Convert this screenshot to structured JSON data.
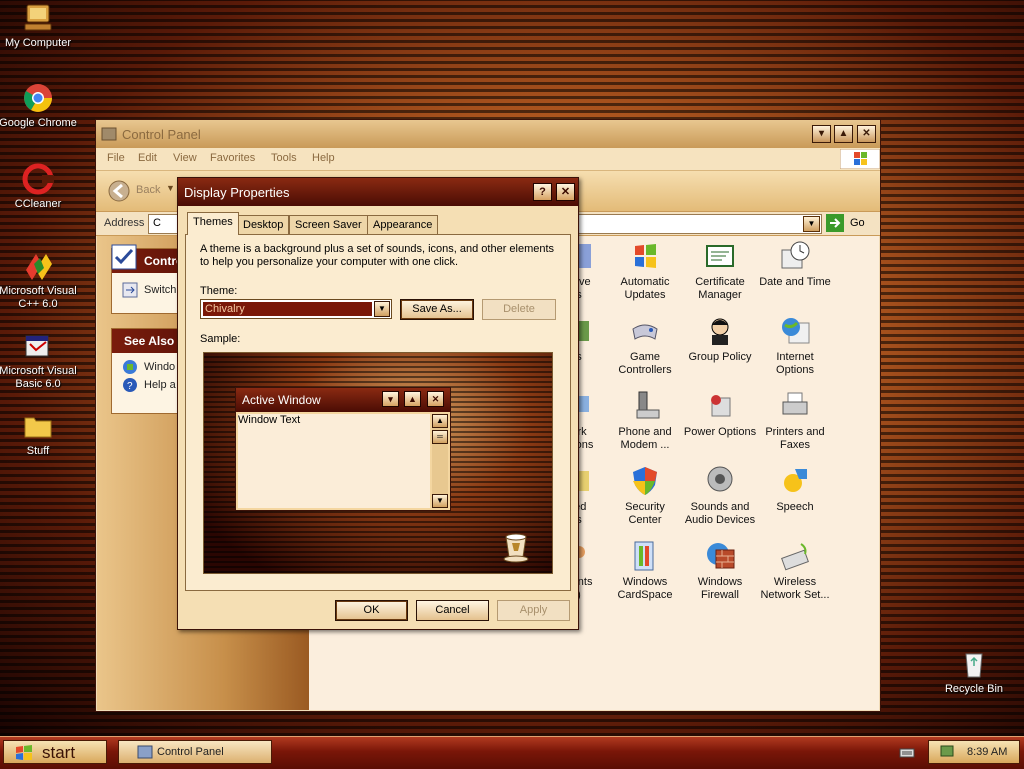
{
  "desktop": {
    "icons": [
      {
        "label": "My Computer"
      },
      {
        "label": "Google Chrome"
      },
      {
        "label": "CCleaner"
      },
      {
        "label": "Microsoft Visual C++ 6.0"
      },
      {
        "label": "Microsoft Visual Basic 6.0"
      },
      {
        "label": "Stuff"
      },
      {
        "label": "Recycle Bin"
      }
    ]
  },
  "control_panel": {
    "title": "Control Panel",
    "menu": [
      "File",
      "Edit",
      "View",
      "Favorites",
      "Tools",
      "Help"
    ],
    "toolbar": {
      "back_label": "Back"
    },
    "address": {
      "label": "Address",
      "value": "C",
      "go_label": "Go"
    },
    "left_pane": {
      "control_header": "Contro",
      "switch_label": "Switch",
      "see_also_header": "See Also",
      "see_also_items": [
        "Windo",
        "Help a"
      ]
    },
    "items": [
      {
        "label": "ative",
        "label2": "s"
      },
      {
        "label": "Automatic",
        "label2": "Updates"
      },
      {
        "label": "Certificate",
        "label2": "Manager"
      },
      {
        "label": "Date and Time",
        "label2": ""
      },
      {
        "label": "s",
        "label2": ""
      },
      {
        "label": "Game",
        "label2": "Controllers"
      },
      {
        "label": "Group Policy",
        "label2": ""
      },
      {
        "label": "Internet",
        "label2": "Options"
      },
      {
        "label": "ork",
        "label2": "ctions"
      },
      {
        "label": "Phone and",
        "label2": "Modem ..."
      },
      {
        "label": "Power Options",
        "label2": ""
      },
      {
        "label": "Printers and",
        "label2": "Faxes"
      },
      {
        "label": "led",
        "label2": "s"
      },
      {
        "label": "Security",
        "label2": "Center"
      },
      {
        "label": "Sounds and",
        "label2": "Audio Devices"
      },
      {
        "label": "Speech",
        "label2": ""
      },
      {
        "label": "ounts",
        "label2": ")"
      },
      {
        "label": "Windows",
        "label2": "CardSpace"
      },
      {
        "label": "Windows",
        "label2": "Firewall"
      },
      {
        "label": "Wireless",
        "label2": "Network Set..."
      }
    ]
  },
  "dialog": {
    "title": "Display Properties",
    "tabs": [
      "Themes",
      "Desktop",
      "Screen Saver",
      "Appearance"
    ],
    "description": "A theme is a background plus a set of sounds, icons, and other elements to help you personalize your computer with one click.",
    "theme_label": "Theme:",
    "theme_value": "Chivalry",
    "save_as_label": "Save As...",
    "delete_label": "Delete",
    "sample_label": "Sample:",
    "sample_window": {
      "title": "Active Window",
      "text": "Window Text"
    },
    "ok_label": "OK",
    "cancel_label": "Cancel",
    "apply_label": "Apply"
  },
  "taskbar": {
    "start_label": "start",
    "task_label": "Control Panel",
    "clock": "8:39 AM"
  }
}
